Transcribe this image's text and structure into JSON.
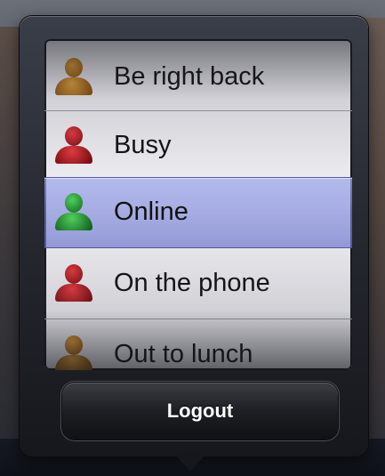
{
  "status_picker": {
    "items": [
      {
        "label": "Be right back",
        "icon": "person-away-icon",
        "color": "#b8740d"
      },
      {
        "label": "Busy",
        "icon": "person-busy-icon",
        "color": "#b0121a"
      },
      {
        "label": "Online",
        "icon": "person-online-icon",
        "color": "#1f8a2e"
      },
      {
        "label": "On the phone",
        "icon": "person-busy-icon",
        "color": "#b0121a"
      },
      {
        "label": "Out to lunch",
        "icon": "person-away-icon",
        "color": "#b8740d"
      }
    ],
    "selected_index": 2
  },
  "logout_label": "Logout"
}
